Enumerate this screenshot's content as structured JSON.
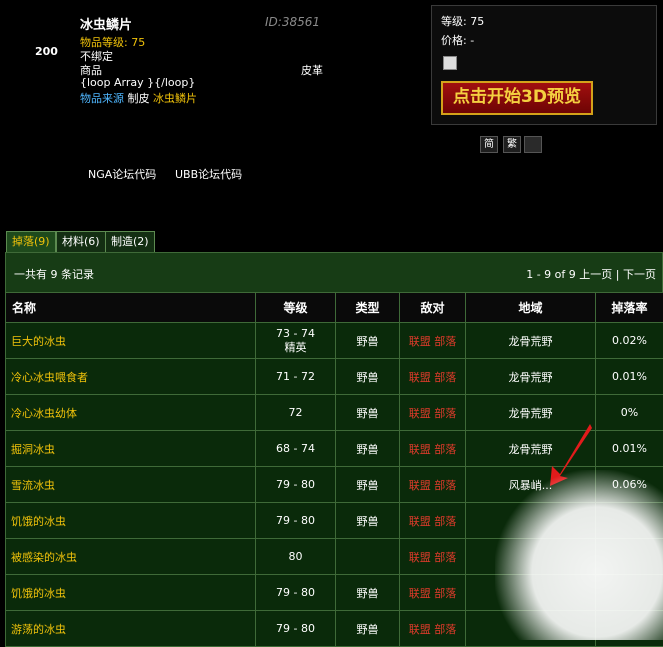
{
  "item": {
    "name": "冰虫鳞片",
    "id": "ID:38561",
    "number": "200",
    "level_label": "物品等级:",
    "level_value": "75",
    "bind": "不绑定",
    "category": "商品",
    "subcategory": "皮革",
    "loop_text": "{loop Array }{/loop}",
    "source_label": "物品来源",
    "source_method": "制皮",
    "source_item": "冰虫鳞片"
  },
  "panel": {
    "level": "等级: 75",
    "price": "价格: -",
    "preview_button": "点击开始3D预览",
    "btn_simplified": "简",
    "btn_traditional": "繁"
  },
  "links": {
    "nga": "NGA论坛代码",
    "ubb": "UBB论坛代码"
  },
  "tabs": [
    "掉落(9)",
    "材料(6)",
    "制造(2)"
  ],
  "records": "一共有 9 条记录",
  "pager": {
    "range": "1 - 9 of 9",
    "prev": "上一页",
    "sep": "|",
    "next": "下一页"
  },
  "table": {
    "headers": [
      "名称",
      "等级",
      "类型",
      "敌对",
      "地域",
      "掉落率"
    ],
    "rows": [
      {
        "name": "巨大的冰虫",
        "level": "73 - 74",
        "level_sub": "精英",
        "type": "野兽",
        "alliance": "联盟",
        "horde": "部落",
        "zone": "龙骨荒野",
        "rate": "0.02%"
      },
      {
        "name": "冷心冰虫喂食者",
        "level": "71 - 72",
        "level_sub": "",
        "type": "野兽",
        "alliance": "联盟",
        "horde": "部落",
        "zone": "龙骨荒野",
        "rate": "0.01%"
      },
      {
        "name": "冷心冰虫幼体",
        "level": "72",
        "level_sub": "",
        "type": "野兽",
        "alliance": "联盟",
        "horde": "部落",
        "zone": "龙骨荒野",
        "rate": "0%"
      },
      {
        "name": "掘洞冰虫",
        "level": "68 - 74",
        "level_sub": "",
        "type": "野兽",
        "alliance": "联盟",
        "horde": "部落",
        "zone": "龙骨荒野",
        "rate": "0.01%"
      },
      {
        "name": "雪流冰虫",
        "level": "79 - 80",
        "level_sub": "",
        "type": "野兽",
        "alliance": "联盟",
        "horde": "部落",
        "zone": "风暴峭...",
        "rate": "0.06%"
      },
      {
        "name": "饥饿的冰虫",
        "level": "79 - 80",
        "level_sub": "",
        "type": "野兽",
        "alliance": "联盟",
        "horde": "部落",
        "zone": "",
        "rate": ""
      },
      {
        "name": "被感染的冰虫",
        "level": "80",
        "level_sub": "",
        "type": "",
        "alliance": "联盟",
        "horde": "部落",
        "zone": "",
        "rate": ""
      },
      {
        "name": "饥饿的冰虫",
        "level": "79 - 80",
        "level_sub": "",
        "type": "野兽",
        "alliance": "联盟",
        "horde": "部落",
        "zone": "",
        "rate": ""
      },
      {
        "name": "游荡的冰虫",
        "level": "79 - 80",
        "level_sub": "",
        "type": "野兽",
        "alliance": "联盟",
        "horde": "部落",
        "zone": "",
        "rate": ""
      }
    ]
  },
  "colors": {
    "accent_yellow": "#f0c20a",
    "link_blue": "#4fb7ff",
    "faction_red": "#e03b2b",
    "table_green": "#173c15"
  }
}
